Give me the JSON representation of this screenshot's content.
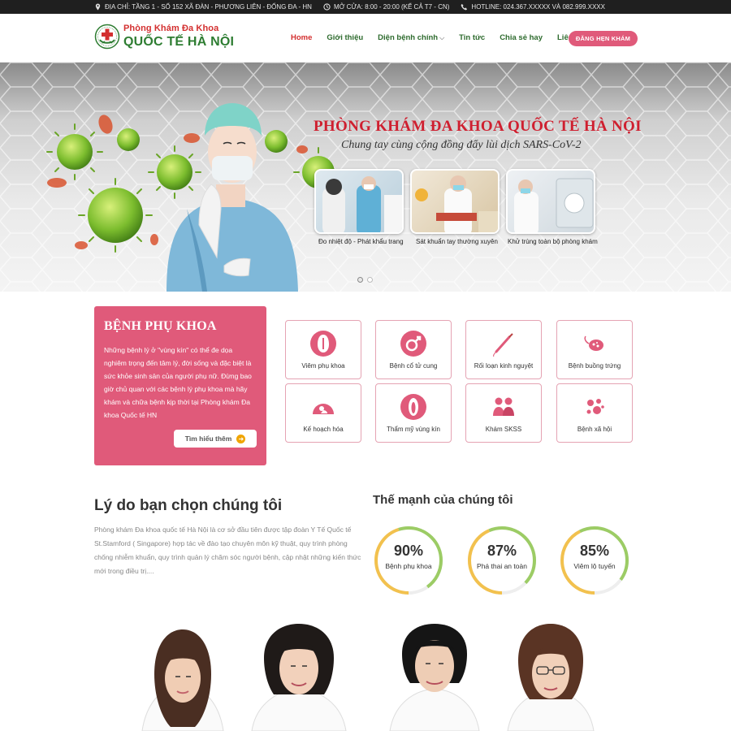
{
  "topbar": {
    "address": "ĐỊA CHỈ: TẦNG 1 - SỐ 152 XÃ ĐÀN - PHƯƠNG LIÊN - ĐỐNG ĐA - HN",
    "hours": "MỞ CỬA: 8:00 - 20:00 (KỂ CẢ T7 - CN)",
    "hotline": "HOTLINE: 024.367.XXXXX VÀ 082.999.XXXX"
  },
  "logo": {
    "line1": "Phòng Khám Đa Khoa",
    "line2": "QUỐC TẾ HÀ NỘI"
  },
  "nav": {
    "items": [
      "Home",
      "Giới thiệu",
      "Diện bệnh chính",
      "Tin tức",
      "Chia sẻ hay",
      "Liên hệ"
    ],
    "cta": "ĐĂNG HẸN KHÁM"
  },
  "hero": {
    "title": "PHÒNG KHÁM ĐA KHOA QUỐC TẾ HÀ NỘI",
    "subtitle": "Chung tay cùng cộng đồng đẩy lùi dịch SARS-CoV-2",
    "cards": [
      "Đo nhiệt độ - Phát khẩu trang",
      "Sát khuẩn tay thường xuyên",
      "Khử trùng toàn bộ phòng khám"
    ],
    "slide_index": 1,
    "slide_count": 2
  },
  "gyn": {
    "title": "BỆNH PHỤ KHOA",
    "text": "Những bệnh lý ở \"vùng kín\" có thể đe dọa nghiêm trọng đến tâm lý, đời sống và đặc biệt là sức khỏe sinh sản của người phụ nữ. Đừng bao giờ chủ quan với các bệnh lý phụ khoa mà hãy khám và chữa bệnh kịp thời tại Phòng khám Đa khoa Quốc tế HN",
    "button": "Tìm hiểu thêm"
  },
  "services": [
    {
      "label": "Viêm phụ khoa",
      "icon": "uterus-icon"
    },
    {
      "label": "Bệnh cổ tử cung",
      "icon": "gender-icon"
    },
    {
      "label": "Rối loạn kinh nguyệt",
      "icon": "tampon-icon"
    },
    {
      "label": "Bệnh buồng trứng",
      "icon": "ovary-icon"
    },
    {
      "label": "Kế hoạch hóa",
      "icon": "ultrasound-icon"
    },
    {
      "label": "Thẩm mỹ vùng kín",
      "icon": "vulva-icon"
    },
    {
      "label": "Khám SKSS",
      "icon": "couple-icon"
    },
    {
      "label": "Bệnh xã hội",
      "icon": "virus-icon"
    }
  ],
  "why": {
    "title": "Lý do bạn chọn chúng tôi",
    "text": "Phòng khám Đa khoa quốc tế Hà Nội là cơ sở đầu tiên được tập đoàn Y Tế Quốc tế St.Stamford ( Singapore) hợp tác về đào tạo chuyên môn kỹ thuật, quy trình phòng chống nhiễm khuẩn, quy trình quản lý chăm sóc người bệnh, cập nhật những kiến thức mới trong điều trị...."
  },
  "strengths": {
    "title": "Thế mạnh của chúng tôi",
    "items": [
      {
        "value": 90,
        "label_pct": "90%",
        "label": "Bệnh phụ khoa"
      },
      {
        "value": 87,
        "label_pct": "87%",
        "label": "Phá thai an toàn"
      },
      {
        "value": 85,
        "label_pct": "85%",
        "label": "Viêm lộ tuyến"
      }
    ]
  },
  "colors": {
    "accent": "#e05a7a",
    "red": "#d32f2f",
    "green": "#2e7d32",
    "ring_yellow": "#f2c14e",
    "ring_green": "#9ccc65"
  }
}
